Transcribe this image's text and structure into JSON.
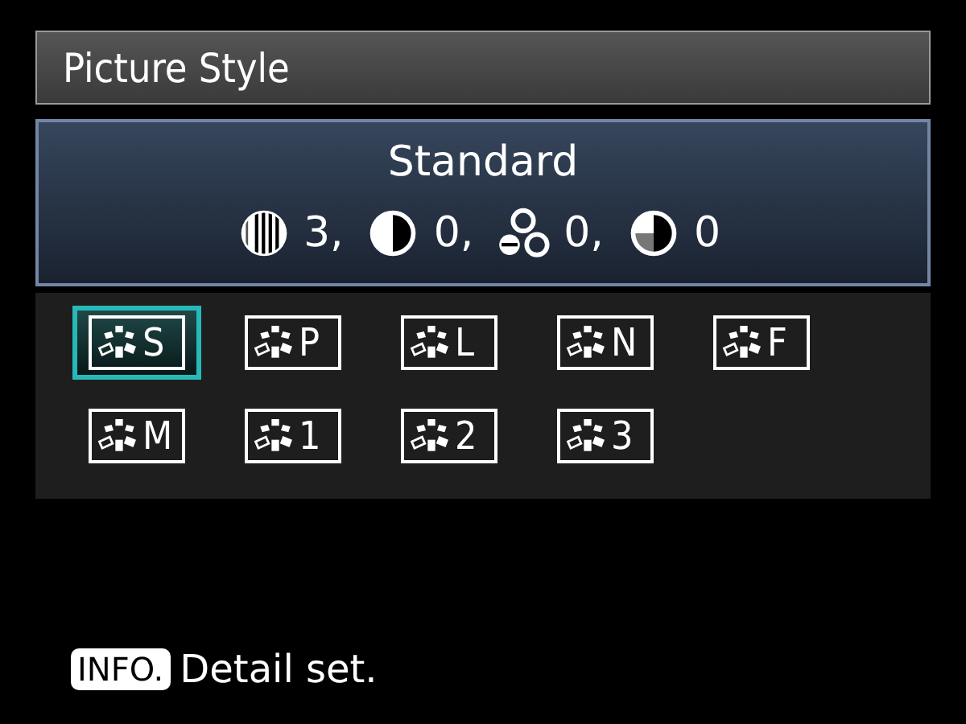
{
  "header": {
    "title": "Picture Style"
  },
  "current": {
    "name": "Standard",
    "parameters": [
      {
        "kind": "sharpness",
        "value": "3,"
      },
      {
        "kind": "contrast",
        "value": "0,"
      },
      {
        "kind": "saturation",
        "value": "0,"
      },
      {
        "kind": "tone",
        "value": "0"
      }
    ]
  },
  "styles": [
    {
      "letter": "S",
      "selected": true
    },
    {
      "letter": "P",
      "selected": false
    },
    {
      "letter": "L",
      "selected": false
    },
    {
      "letter": "N",
      "selected": false
    },
    {
      "letter": "F",
      "selected": false
    },
    {
      "letter": "M",
      "selected": false
    },
    {
      "letter": "1",
      "selected": false
    },
    {
      "letter": "2",
      "selected": false
    },
    {
      "letter": "3",
      "selected": false
    }
  ],
  "footer": {
    "button": "INFO.",
    "hint": "Detail set."
  }
}
